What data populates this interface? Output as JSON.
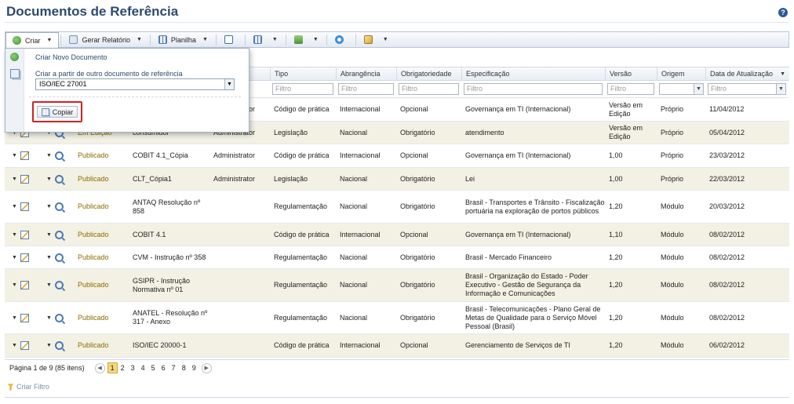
{
  "page": {
    "title": "Documentos de Referência",
    "help_label": "?"
  },
  "toolbar": {
    "create_label": "Criar",
    "report_label": "Gerar Relatório",
    "sheet_label": "Planilha"
  },
  "popup": {
    "new_doc_label": "Criar Novo Documento",
    "from_ref_label": "Criar a partir de outro documento de referência",
    "selected_ref": "ISO/IEC 27001",
    "copy_label": "Copiar"
  },
  "columns": {
    "tipo": "Tipo",
    "abrangencia": "Abrangência",
    "obrigatoriedade": "Obrigatoriedade",
    "especificacao": "Especificação",
    "versao": "Versão",
    "origem": "Origem",
    "data": "Data de Atualização"
  },
  "filter_placeholder": "Filtro",
  "rows": [
    {
      "status": "",
      "nome": "",
      "autor": "Administrator",
      "tipo": "Código de prática",
      "abrangencia": "Internacional",
      "obrig": "Opcional",
      "espec": "Governança em TI (Internacional)",
      "versao": "Versão em Edição",
      "origem": "Próprio",
      "data": "11/04/2012"
    },
    {
      "status": "Em Edição",
      "nome": "consumidor",
      "autor": "Administrator",
      "tipo": "Legislação",
      "abrangencia": "Nacional",
      "obrig": "Obrigatório",
      "espec": "atendimento",
      "versao": "Versão em Edição",
      "origem": "Próprio",
      "data": "05/04/2012"
    },
    {
      "status": "Publicado",
      "nome": "COBIT 4.1_Cópia",
      "autor": "Administrator",
      "tipo": "Código de prática",
      "abrangencia": "Internacional",
      "obrig": "Opcional",
      "espec": "Governança em TI (Internacional)",
      "versao": "1,00",
      "origem": "Próprio",
      "data": "23/03/2012"
    },
    {
      "status": "Publicado",
      "nome": "CLT_Cópia1",
      "autor": "Administrator",
      "tipo": "Legislação",
      "abrangencia": "Nacional",
      "obrig": "Obrigatório",
      "espec": "Lei",
      "versao": "1,00",
      "origem": "Próprio",
      "data": "22/03/2012"
    },
    {
      "status": "Publicado",
      "nome": "ANTAQ Resolução nº 858",
      "autor": "",
      "tipo": "Regulamentação",
      "abrangencia": "Nacional",
      "obrig": "Obrigatório",
      "espec": "Brasil - Transportes e Trânsito - Fiscalização portuária na exploração de portos públicos",
      "versao": "1,20",
      "origem": "Módulo",
      "data": "20/03/2012"
    },
    {
      "status": "Publicado",
      "nome": "COBIT 4.1",
      "autor": "",
      "tipo": "Código de prática",
      "abrangencia": "Internacional",
      "obrig": "Opcional",
      "espec": "Governança em TI (Internacional)",
      "versao": "1,10",
      "origem": "Módulo",
      "data": "08/02/2012"
    },
    {
      "status": "Publicado",
      "nome": "CVM - Instrução nº 358",
      "autor": "",
      "tipo": "Regulamentação",
      "abrangencia": "Nacional",
      "obrig": "Obrigatório",
      "espec": "Brasil - Mercado Financeiro",
      "versao": "1,20",
      "origem": "Módulo",
      "data": "08/02/2012"
    },
    {
      "status": "Publicado",
      "nome": "GSIPR - Instrução Normativa nº 01",
      "autor": "",
      "tipo": "Regulamentação",
      "abrangencia": "Nacional",
      "obrig": "Obrigatório",
      "espec": "Brasil - Organização do Estado - Poder Executivo - Gestão de Segurança da Informação e Comunicações",
      "versao": "1,20",
      "origem": "Módulo",
      "data": "08/02/2012"
    },
    {
      "status": "Publicado",
      "nome": "ANATEL - Resolução nº 317 - Anexo",
      "autor": "",
      "tipo": "Regulamentação",
      "abrangencia": "Nacional",
      "obrig": "Obrigatório",
      "espec": "Brasil - Telecomunicações - Plano Geral de Metas de Qualidade para o Serviço Móvel Pessoal (Brasil)",
      "versao": "1,20",
      "origem": "Módulo",
      "data": "08/02/2012"
    },
    {
      "status": "Publicado",
      "nome": "ISO/IEC 20000-1",
      "autor": "",
      "tipo": "Código de prática",
      "abrangencia": "Internacional",
      "obrig": "Opcional",
      "espec": "Gerenciamento de Serviços de TI",
      "versao": "1,20",
      "origem": "Módulo",
      "data": "06/02/2012"
    }
  ],
  "pager": {
    "info": "Página 1 de 9 (85 itens)",
    "pages": [
      "1",
      "2",
      "3",
      "4",
      "5",
      "6",
      "7",
      "8",
      "9"
    ],
    "current": "1"
  },
  "footer": {
    "create_filter": "Criar Filtro"
  }
}
